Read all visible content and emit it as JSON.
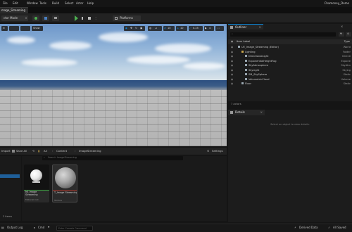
{
  "menu": {
    "items": [
      "File",
      "Edit",
      "Window",
      "Tools",
      "Build",
      "Select",
      "Actor",
      "Help"
    ],
    "project": "Chamoney_Demo"
  },
  "level_tab": "mage_Streaming",
  "toolbar": {
    "mode": "ctor Mode",
    "platforms": "Platforms"
  },
  "viewport": {
    "left_buttons": [
      "",
      "",
      "Show"
    ],
    "right_values": [
      "10",
      "10",
      "0.25",
      "4"
    ]
  },
  "outliner": {
    "title": "Outliner",
    "header_label": "Item Label",
    "header_type": "Type",
    "rows": [
      {
        "label": "UE_Image_Streaming (Editor)",
        "type": "World",
        "depth": 0
      },
      {
        "label": "Lighting",
        "type": "Folder",
        "depth": 1
      },
      {
        "label": "DirectionalLight",
        "type": "Directi",
        "depth": 2
      },
      {
        "label": "ExponentialHeightFog",
        "type": "Expone",
        "depth": 2
      },
      {
        "label": "SkyAtmosphere",
        "type": "SkyAtm",
        "depth": 2
      },
      {
        "label": "SkyLight",
        "type": "SkyLig",
        "depth": 2
      },
      {
        "label": "SM_SkySphere",
        "type": "Static",
        "depth": 2
      },
      {
        "label": "VolumetricCloud",
        "type": "Volume",
        "depth": 2
      },
      {
        "label": "Floor",
        "type": "Static",
        "depth": 1
      }
    ],
    "actors_count": "7 actors"
  },
  "details": {
    "title": "Details",
    "empty_text": "Select an object to view details."
  },
  "content_browser": {
    "import": "Import",
    "save_all": "Save All",
    "path": [
      "All",
      "Content",
      "ImageStreaming"
    ],
    "settings": "Settings",
    "search_placeholder": "Search ImageStreaming",
    "assets": [
      {
        "name": "MI_Image Streaming",
        "type": "Material Inst",
        "stripe": "#3fae44",
        "thumb": "sphere-white"
      },
      {
        "name": "T_Image Streaming",
        "type": "Texture",
        "stripe": "#c0392b",
        "thumb": "sphere-grey"
      }
    ],
    "items_count": "2 items"
  },
  "statusbar": {
    "output_log": "Output Log",
    "cmd": "Cmd",
    "cmd_placeholder": "Enter Console Command",
    "derived_data": "Derived Data",
    "all_saved": "All Saved"
  },
  "colors": {
    "accent_blue": "#0a84d6",
    "play_green": "#4caf50",
    "material_stripe": "#3fae44",
    "texture_stripe": "#c0392b"
  }
}
